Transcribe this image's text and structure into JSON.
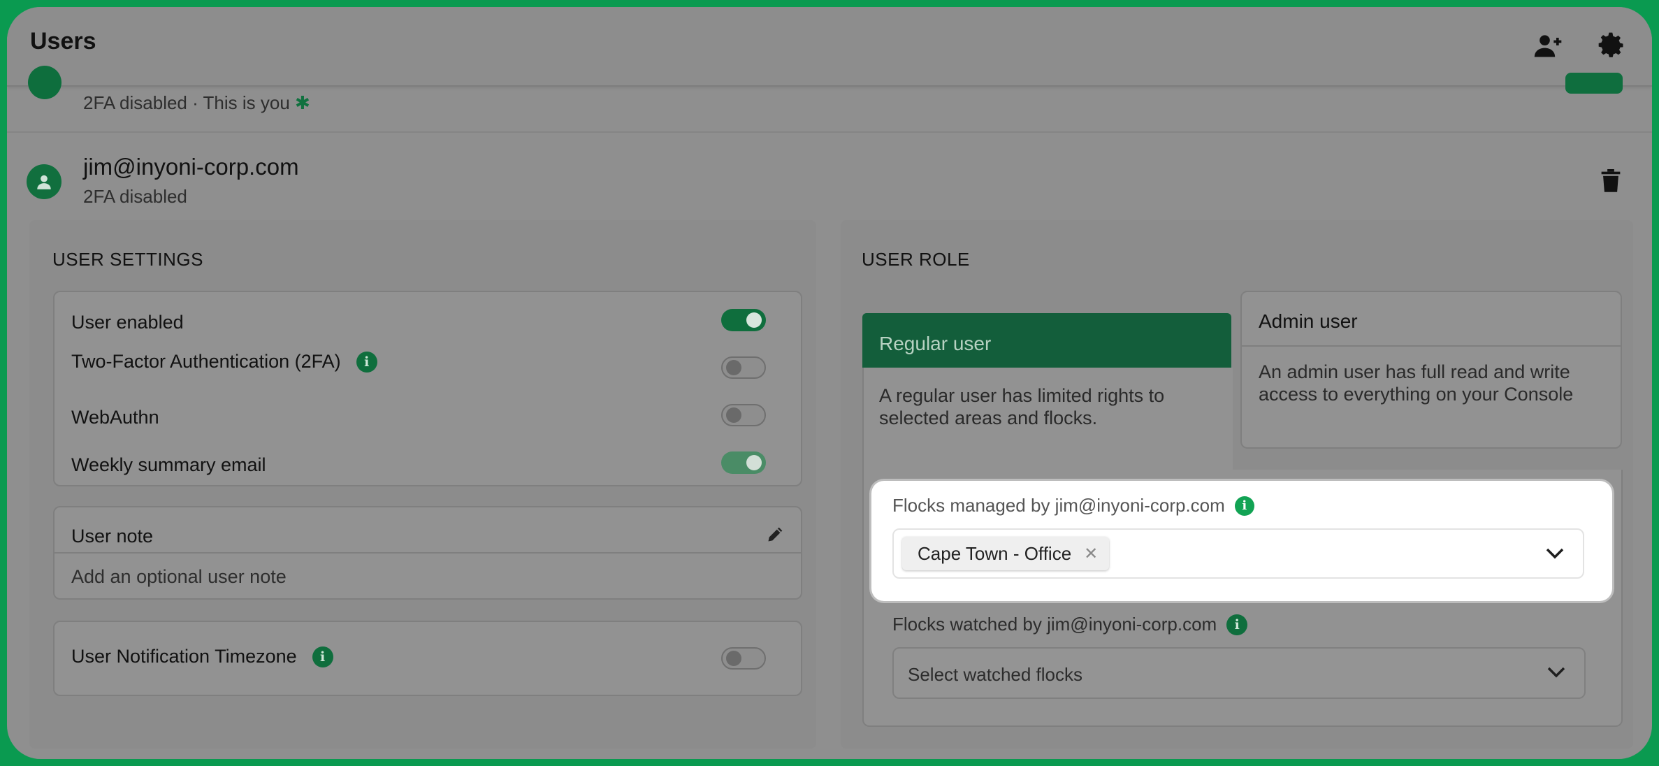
{
  "header": {
    "title": "Users",
    "add_user_icon": "add-user-icon",
    "settings_icon": "gear-icon"
  },
  "current_user": {
    "subtitle": "2FA disabled · This is you",
    "marker": "✱"
  },
  "user": {
    "email": "jim@inyoni-corp.com",
    "subtitle": "2FA disabled"
  },
  "user_settings": {
    "title": "USER SETTINGS",
    "items": [
      {
        "label": "User enabled",
        "state": "on"
      },
      {
        "label": "Two-Factor Authentication (2FA)",
        "state": "off",
        "info": true
      },
      {
        "label": "WebAuthn",
        "state": "off"
      },
      {
        "label": "Weekly summary email",
        "state": "on"
      }
    ],
    "note": {
      "title": "User note",
      "placeholder": "Add an optional user note"
    },
    "timezone": {
      "label": "User Notification Timezone",
      "state": "off"
    }
  },
  "user_role": {
    "title": "USER ROLE",
    "regular": {
      "label": "Regular user",
      "description": "A regular user has limited rights to selected areas and flocks."
    },
    "admin": {
      "label": "Admin user",
      "description": "An admin user has full read and write access to everything on your Console"
    }
  },
  "flocks": {
    "managed_label": "Flocks managed by jim@inyoni-corp.com",
    "managed_selected": [
      "Cape Town - Office"
    ],
    "watched_label": "Flocks watched by jim@inyoni-corp.com",
    "watched_placeholder": "Select watched flocks"
  },
  "info_glyph": "i",
  "remove_glyph": "✕",
  "colors": {
    "brand_green": "#0a9a50",
    "accent_dark": "#0f6e3d"
  }
}
